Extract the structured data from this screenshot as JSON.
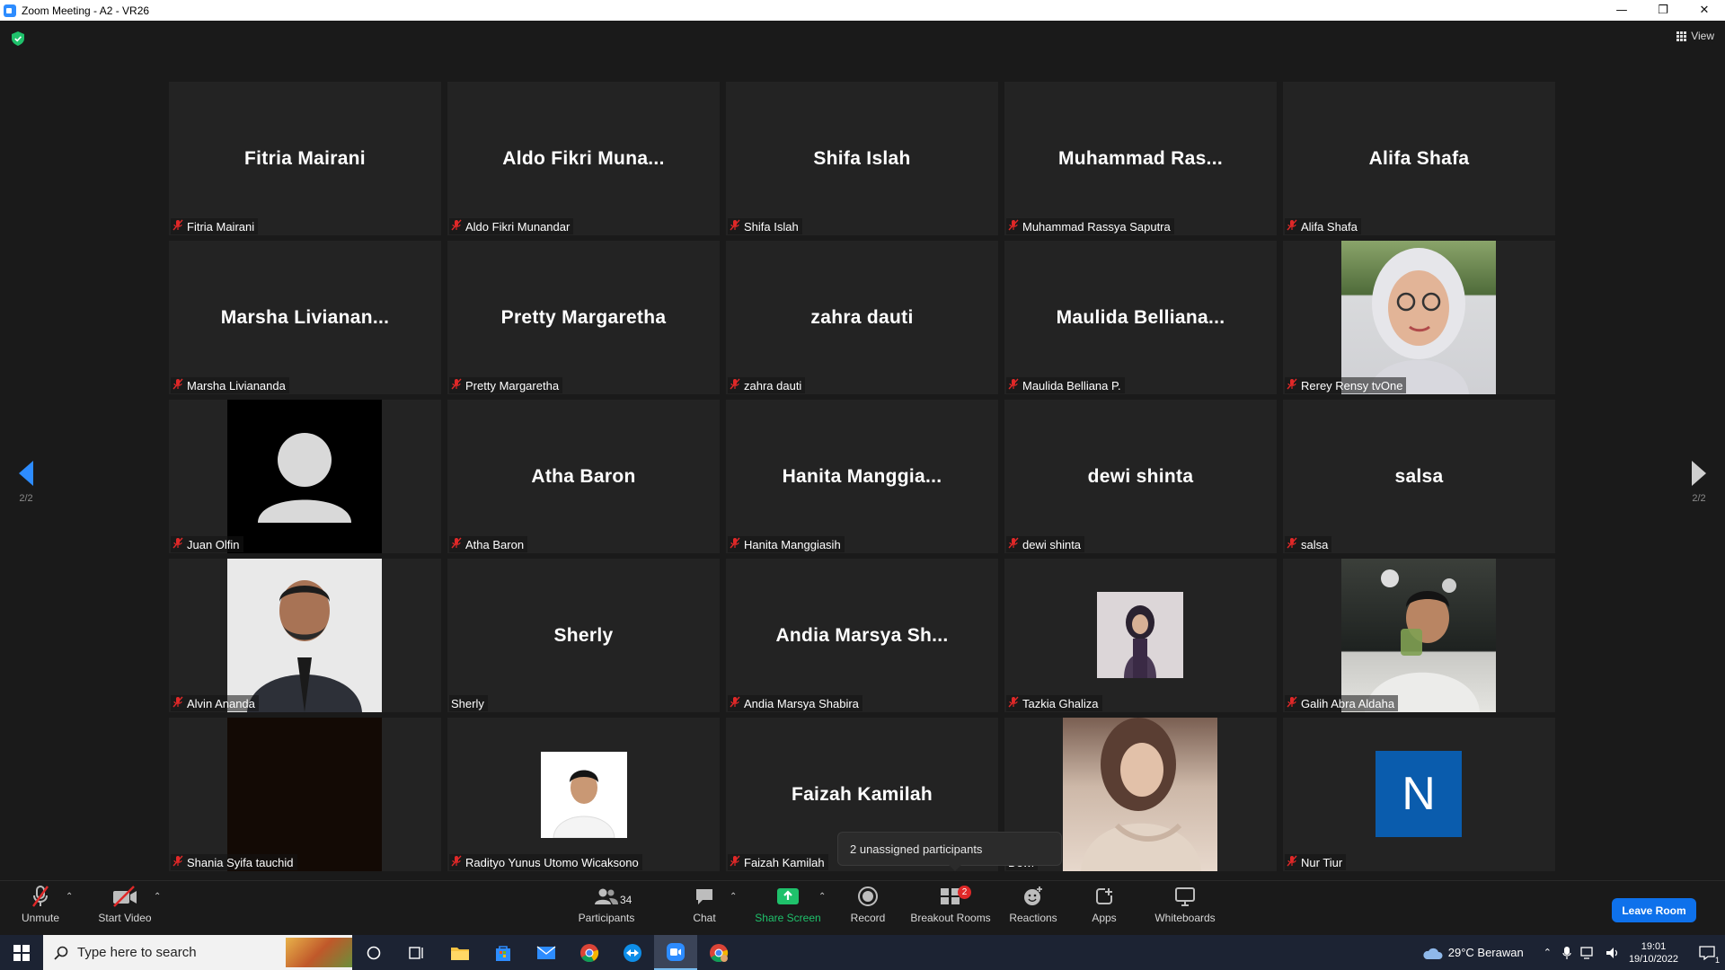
{
  "window": {
    "title": "Zoom Meeting - A2 - VR26",
    "controls": [
      "minimize-icon",
      "restore-icon",
      "close-icon"
    ]
  },
  "meeting": {
    "view_label": "View",
    "page_indicator": "2/2",
    "unassigned_popup": "2 unassigned participants",
    "tiles": [
      {
        "display": "Fitria Mairani",
        "name": "Fitria Mairani",
        "muted": true,
        "video": "none"
      },
      {
        "display": "Aldo  Fikri  Muna...",
        "name": "Aldo Fikri Munandar",
        "muted": true,
        "video": "none"
      },
      {
        "display": "Shifa Islah",
        "name": "Shifa Islah",
        "muted": true,
        "video": "none"
      },
      {
        "display": "Muhammad  Ras...",
        "name": "Muhammad Rassya Saputra",
        "muted": true,
        "video": "none"
      },
      {
        "display": "Alifa Shafa",
        "name": "Alifa Shafa",
        "muted": true,
        "video": "none"
      },
      {
        "display": "Marsha  Livianan...",
        "name": "Marsha Livianandа",
        "muted": true,
        "video": "none"
      },
      {
        "display": "Pretty Margaretha",
        "name": "Pretty Margaretha",
        "muted": true,
        "video": "none"
      },
      {
        "display": "zahra dauti",
        "name": "zahra dauti",
        "muted": true,
        "video": "none"
      },
      {
        "display": "Maulida  Belliana...",
        "name": "Maulida Belliana P.",
        "muted": true,
        "video": "none"
      },
      {
        "display": "",
        "name": "Rerey Rensy tvOne",
        "muted": true,
        "video": "photo-hijab-glasses"
      },
      {
        "display": "",
        "name": "Juan Olfin",
        "muted": true,
        "video": "default-avatar"
      },
      {
        "display": "Atha Baron",
        "name": "Atha Baron",
        "muted": true,
        "video": "none"
      },
      {
        "display": "Hanita  Manggia...",
        "name": "Hanita Manggiasih",
        "muted": true,
        "video": "none"
      },
      {
        "display": "dewi shinta",
        "name": "dewi shinta",
        "muted": true,
        "video": "none"
      },
      {
        "display": "salsa",
        "name": "salsa",
        "muted": true,
        "video": "none"
      },
      {
        "display": "",
        "name": "Alvin Ananda",
        "muted": true,
        "video": "photo-man-suit"
      },
      {
        "display": "Sherly",
        "name": "Sherly",
        "muted": false,
        "video": "none"
      },
      {
        "display": "Andia  Marsya  Sh...",
        "name": "Andia Marsya Shabira",
        "muted": true,
        "video": "none"
      },
      {
        "display": "",
        "name": "Tazkia Ghaliza",
        "muted": true,
        "video": "photo-small-hijab"
      },
      {
        "display": "",
        "name": "Galih Abra Aldaha",
        "muted": true,
        "video": "photo-young-man"
      },
      {
        "display": "",
        "name": "Shania Syifa tauchid",
        "muted": true,
        "video": "dark-video"
      },
      {
        "display": "",
        "name": "Radityo Yunus Utomo Wicaksono",
        "muted": true,
        "video": "photo-small-man"
      },
      {
        "display": "Faizah Kamilah",
        "name": "Faizah Kamilah",
        "muted": true,
        "video": "none"
      },
      {
        "display": "",
        "name": "Dewi",
        "muted": false,
        "video": "photo-woman-sweater"
      },
      {
        "display": "",
        "name": "Nur Tiur",
        "muted": true,
        "video": "initial-N"
      }
    ]
  },
  "toolbar": {
    "unmute": "Unmute",
    "start_video": "Start Video",
    "participants": "Participants",
    "participant_count": "34",
    "chat": "Chat",
    "share_screen": "Share Screen",
    "record": "Record",
    "breakout_rooms": "Breakout Rooms",
    "breakout_badge": "2",
    "reactions": "Reactions",
    "apps": "Apps",
    "whiteboards": "Whiteboards",
    "leave": "Leave Room"
  },
  "taskbar": {
    "search_placeholder": "Type here to search",
    "weather": "29°C  Berawan",
    "time": "19:01",
    "date": "19/10/2022",
    "notification_count": "1"
  },
  "colors": {
    "accent": "#0e71eb",
    "share_green": "#1fc16b",
    "muted_red": "#e02828",
    "tile_bg": "#232323"
  }
}
